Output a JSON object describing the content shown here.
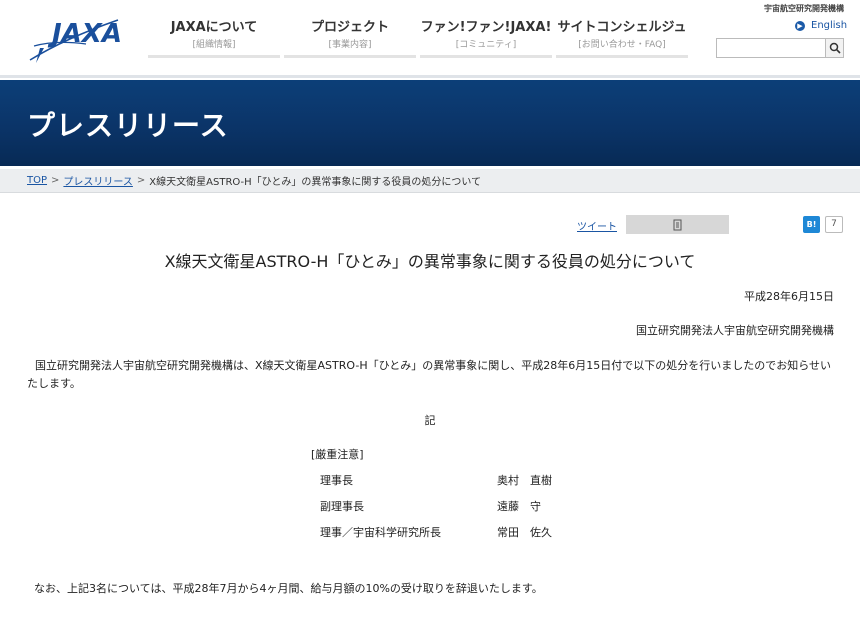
{
  "header": {
    "logo_text": "JAXA",
    "agency_name": "宇宙航空研究開発機構",
    "nav": [
      {
        "label": "JAXAについて",
        "sub": "[組織情報]"
      },
      {
        "label": "プロジェクト",
        "sub": "[事業内容]"
      },
      {
        "label": "ファン!ファン!JAXA!",
        "sub": "[コミュニティ]"
      },
      {
        "label": "サイトコンシェルジュ",
        "sub": "[お問い合わせ・FAQ]"
      }
    ],
    "english_link": "English",
    "search_placeholder": ""
  },
  "banner": {
    "title": "プレスリリース"
  },
  "breadcrumb": {
    "items": [
      "TOP",
      "プレスリリース"
    ],
    "current": "X線天文衛星ASTRO-H「ひとみ」の異常事象に関する役員の処分について",
    "separator": ">"
  },
  "share": {
    "tweet_label": "ツイート",
    "hatena_label": "B!",
    "hatena_count": "7"
  },
  "article": {
    "title": "X線天文衛星ASTRO-H「ひとみ」の異常事象に関する役員の処分について",
    "date": "平成28年6月15日",
    "org": "国立研究開発法人宇宙航空研究開発機構",
    "body": "国立研究開発法人宇宙航空研究開発機構は、X線天文衛星ASTRO-H「ひとみ」の異常事象に関し、平成28年6月15日付で以下の処分を行いましたのでお知らせいたします。",
    "ki": "記",
    "section_heading": "[厳重注意]",
    "officers": [
      {
        "role": "理事長",
        "name": "奥村　直樹"
      },
      {
        "role": "副理事長",
        "name": "遠藤　守"
      },
      {
        "role": "理事／宇宙科学研究所長",
        "name": "常田　佐久"
      }
    ],
    "note": "なお、上記3名については、平成28年7月から4ヶ月間、給与月額の10%の受け取りを辞退いたします。"
  },
  "colors": {
    "banner": "#0b3468",
    "link": "#1a55a3",
    "hatena": "#1e88d6"
  }
}
